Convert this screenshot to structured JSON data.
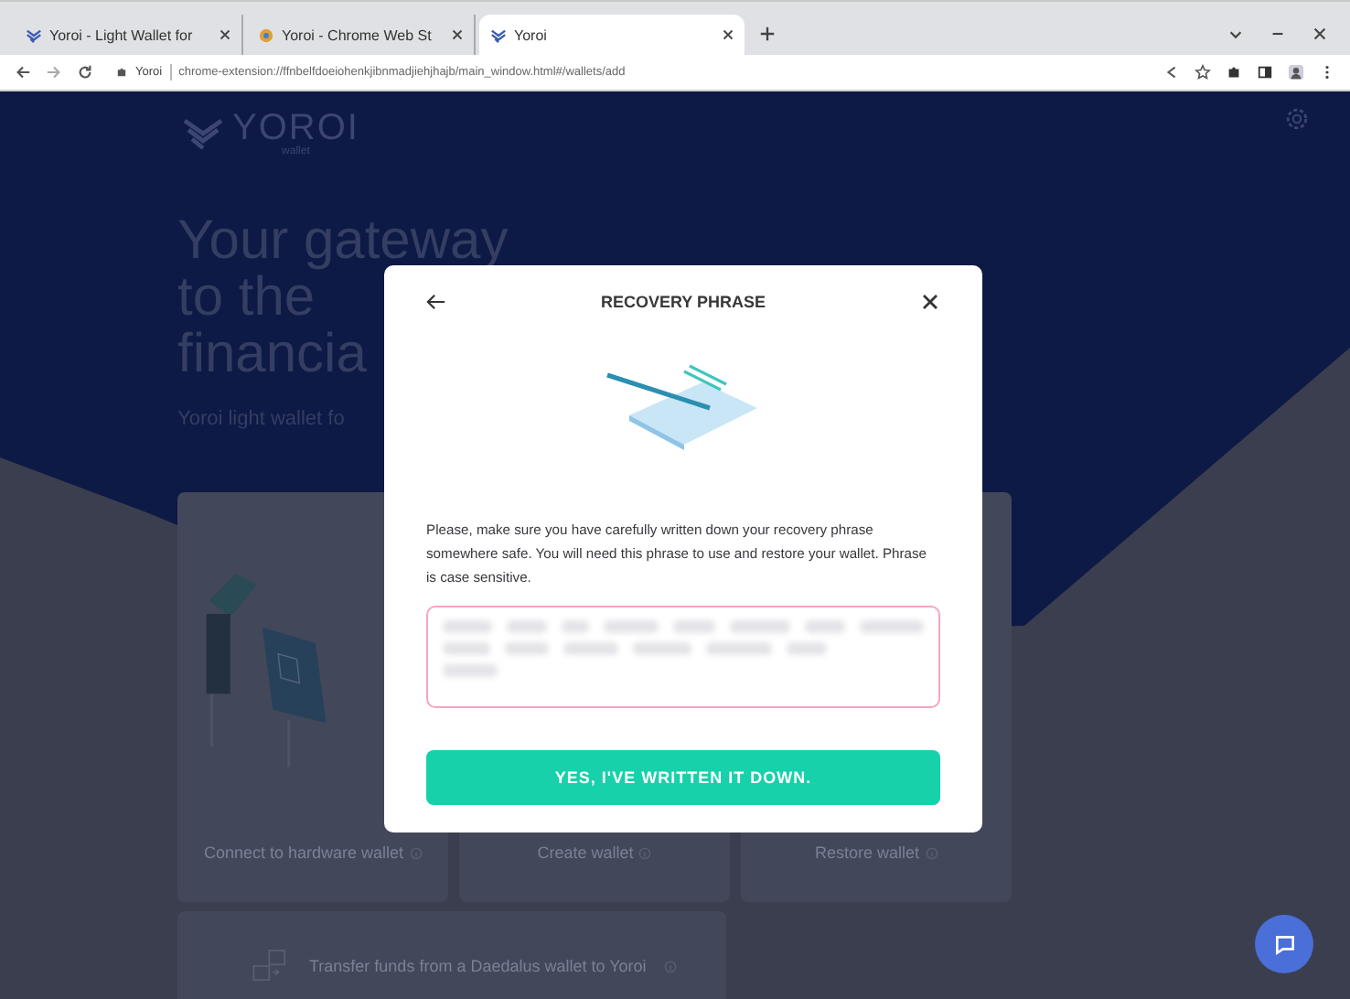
{
  "browser": {
    "tabs": [
      {
        "title": "Yoroi - Light Wallet for",
        "selected": false,
        "kind": "yoroi"
      },
      {
        "title": "Yoroi - Chrome Web St",
        "selected": false,
        "kind": "store"
      },
      {
        "title": "Yoroi",
        "selected": true,
        "kind": "yoroi"
      }
    ],
    "address": {
      "site": "Yoroi",
      "url": "chrome-extension://ffnbelfdoeiohenkjibnmadjiehjhajb/main_window.html#/wallets/add"
    }
  },
  "page": {
    "logo": {
      "name": "YOROI",
      "tagline": "wallet"
    },
    "heading": [
      "Your gateway",
      "to the",
      "financia"
    ],
    "subtitle": "Yoroi light wallet fo",
    "cards": [
      {
        "label": "Connect to hardware wallet",
        "kind": "hardware"
      },
      {
        "label": "Create wallet",
        "kind": "create"
      },
      {
        "label": "Restore wallet",
        "kind": "restore"
      }
    ],
    "transfer": {
      "label": "Transfer funds from a Daedalus wallet to Yoroi"
    }
  },
  "modal": {
    "title": "RECOVERY PHRASE",
    "text": "Please, make sure you have carefully written down your recovery phrase somewhere safe. You will need this phrase to use and restore your wallet. Phrase is case sensitive.",
    "button": "YES, I'VE WRITTEN IT DOWN."
  }
}
